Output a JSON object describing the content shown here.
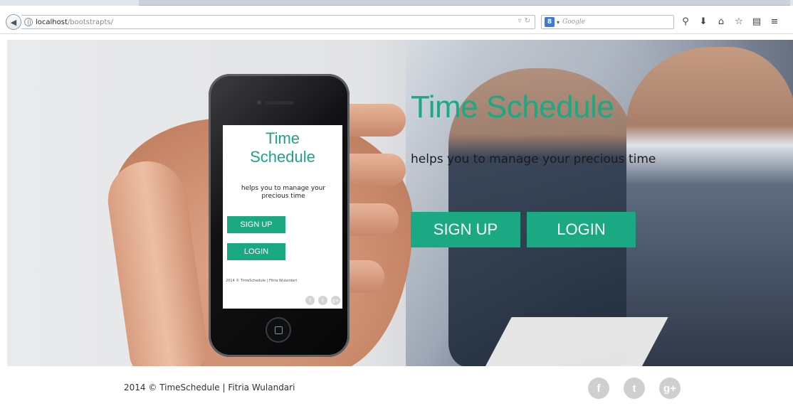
{
  "browser": {
    "url_host": "localhost",
    "url_path": "/bootstrapts/",
    "search_placeholder": "Google",
    "search_engine_badge": "8"
  },
  "hero": {
    "title": "Time Schedule",
    "tagline": "helps you to manage your precious time",
    "signup_label": "SIGN UP",
    "login_label": "LOGIN"
  },
  "phone_screen": {
    "title_line1": "Time",
    "title_line2": "Schedule",
    "tagline": "helps you to manage your precious time",
    "signup_label": "SIGN UP",
    "login_label": "LOGIN",
    "footer": "2014 © TimeSchedule | Fitria Wulandari"
  },
  "footer": {
    "copyright": "2014 © TimeSchedule | Fitria Wulandari",
    "social": {
      "facebook": "f",
      "twitter": "t",
      "googleplus": "g+"
    }
  },
  "colors": {
    "accent": "#1aa983",
    "social_grey": "#cfcfcf"
  },
  "icons": [
    "back-arrow-icon",
    "globe-icon",
    "reload-icon",
    "magnifier-icon",
    "download-icon",
    "home-icon",
    "star-icon",
    "reader-icon",
    "menu-icon",
    "facebook-icon",
    "twitter-icon",
    "google-plus-icon"
  ]
}
